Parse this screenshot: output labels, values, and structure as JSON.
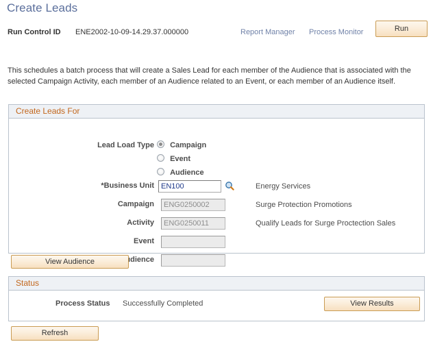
{
  "page": {
    "title": "Create Leads",
    "intro": "This schedules a batch process that will create a Sales Lead for each member of the Audience that is associated with the selected Campaign Activity, each member of an Audience related to an Event, or each member of an Audience itself."
  },
  "header": {
    "run_control_label": "Run Control ID",
    "run_control_value": "ENE2002-10-09-14.29.37.000000",
    "report_manager_link": "Report Manager",
    "process_monitor_link": "Process Monitor",
    "run_button": "Run"
  },
  "create_leads_for": {
    "section_title": "Create Leads For",
    "lead_load_type_label": "Lead Load Type",
    "radio_options": [
      {
        "label": "Campaign",
        "checked": true
      },
      {
        "label": "Event",
        "checked": false
      },
      {
        "label": "Audience",
        "checked": false
      }
    ],
    "fields": [
      {
        "label": "*Business Unit",
        "value": "EN100",
        "description": "Energy Services",
        "disabled": false,
        "has_lookup": true
      },
      {
        "label": "Campaign",
        "value": "ENG0250002",
        "description": "Surge Protection Promotions",
        "disabled": true,
        "has_lookup": false
      },
      {
        "label": "Activity",
        "value": "ENG0250011",
        "description": "Qualify Leads for Surge Proctection Sales",
        "disabled": true,
        "has_lookup": false
      },
      {
        "label": "Event",
        "value": "",
        "description": "",
        "disabled": true,
        "has_lookup": false
      },
      {
        "label": "Audience",
        "value": "",
        "description": "",
        "disabled": true,
        "has_lookup": false
      }
    ],
    "view_audience_button": "View Audience"
  },
  "status": {
    "section_title": "Status",
    "process_status_label": "Process Status",
    "process_status_value": "Successfully Completed",
    "view_results_button": "View Results"
  },
  "footer": {
    "refresh_button": "Refresh"
  },
  "icons": {
    "lookup": "magnifying-glass-icon"
  },
  "colors": {
    "page_title": "#5b6f9c",
    "link": "#7082a8",
    "section_header_text": "#c2661b",
    "section_header_bg": "#eef1f5",
    "button_border": "#c99b52",
    "panel_border": "#b9c2cc",
    "input_text": "#1f3a8a"
  }
}
